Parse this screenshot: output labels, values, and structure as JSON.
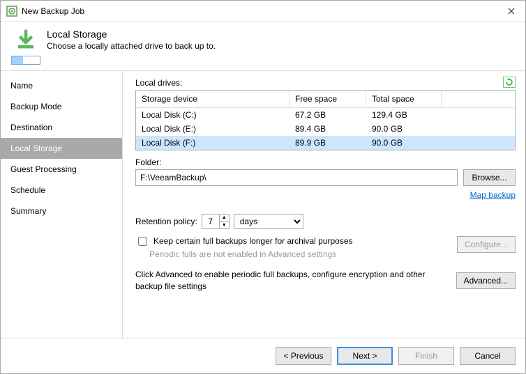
{
  "window": {
    "title": "New Backup Job"
  },
  "header": {
    "heading": "Local Storage",
    "subtitle": "Choose a locally attached drive to back up to."
  },
  "nav": {
    "items": [
      {
        "label": "Name"
      },
      {
        "label": "Backup Mode"
      },
      {
        "label": "Destination"
      },
      {
        "label": "Local Storage"
      },
      {
        "label": "Guest Processing"
      },
      {
        "label": "Schedule"
      },
      {
        "label": "Summary"
      }
    ],
    "active_index": 3
  },
  "drives": {
    "label": "Local drives:",
    "columns": {
      "device": "Storage device",
      "free": "Free space",
      "total": "Total space"
    },
    "rows": [
      {
        "device": "Local Disk (C:)",
        "free": "67.2 GB",
        "total": "129.4 GB"
      },
      {
        "device": "Local Disk (E:)",
        "free": "89.4 GB",
        "total": "90.0 GB"
      },
      {
        "device": "Local Disk (F:)",
        "free": "89.9 GB",
        "total": "90.0 GB"
      }
    ],
    "selected_index": 2
  },
  "folder": {
    "label": "Folder:",
    "value": "F:\\VeeamBackup\\",
    "browse": "Browse..."
  },
  "map_link": "Map backup",
  "retention": {
    "label": "Retention policy:",
    "value": "7",
    "unit": "days"
  },
  "archival": {
    "checkbox_label": "Keep certain full backups longer for archival purposes",
    "hint": "Periodic fulls are not enabled in Advanced settings",
    "configure": "Configure..."
  },
  "advanced": {
    "text": "Click Advanced to enable periodic full backups, configure encryption and other backup file settings",
    "button": "Advanced..."
  },
  "footer": {
    "previous": "< Previous",
    "next": "Next >",
    "finish": "Finish",
    "cancel": "Cancel"
  }
}
